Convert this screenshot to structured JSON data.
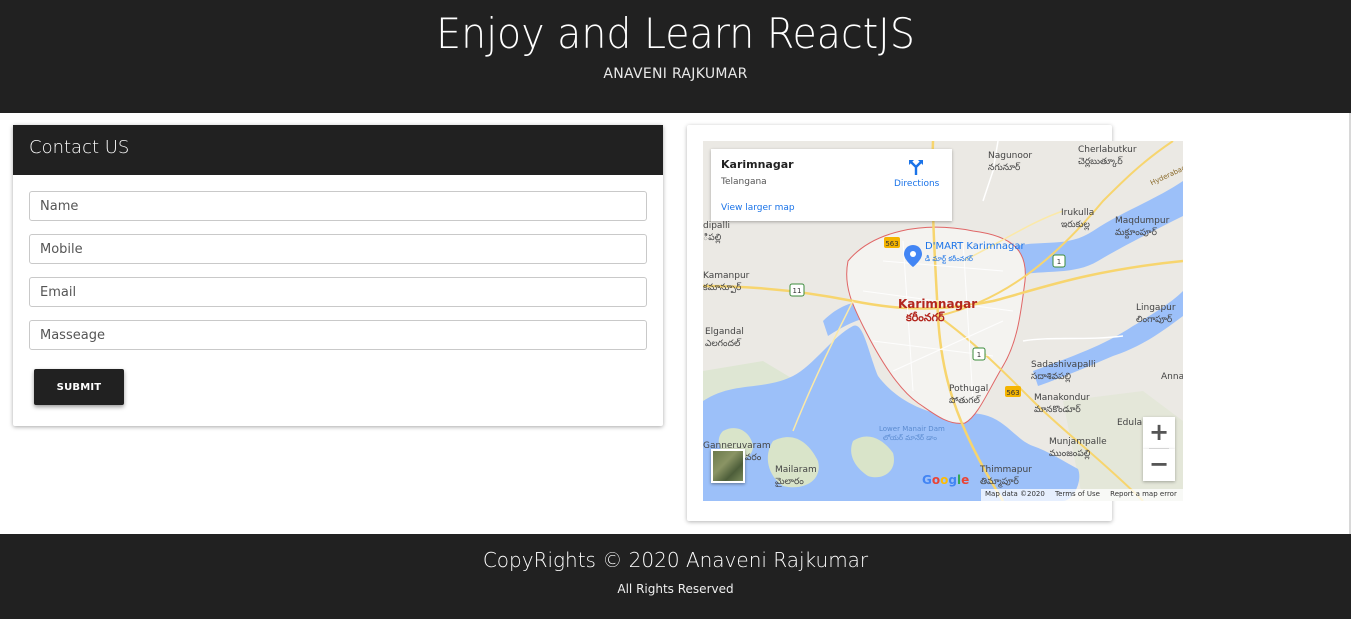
{
  "header": {
    "title": "Enjoy and Learn ReactJS",
    "subtitle": "ANAVENI RAJKUMAR"
  },
  "contact": {
    "heading": "Contact US",
    "fields": {
      "name_placeholder": "Name",
      "mobile_placeholder": "Mobile",
      "email_placeholder": "Email",
      "message_placeholder": "Masseage"
    },
    "submit_label": "SUBMIT"
  },
  "map": {
    "place_name": "Karimnagar",
    "place_region": "Telangana",
    "directions_label": "Directions",
    "larger_map_label": "View larger map",
    "zoom_in": "+",
    "zoom_out": "−",
    "google_logo": "Google",
    "attribution": {
      "map_data": "Map data ©2020",
      "terms": "Terms of Use",
      "report": "Report a map error"
    },
    "labels": {
      "nagunoor": "Nagunoor",
      "nagunoor_te": "నగునూర్",
      "cherlabutkur": "Cherlabutkur",
      "cherlabutkur_te": "చెర్లబుత్కూర్",
      "irukulla": "Irukulla",
      "irukulla_te": "ఇరుకుల్ల",
      "maqdumpur": "Maqdumpur",
      "maqdumpur_te": "మక్దూంపూర్",
      "dipalli": "dipalli",
      "dipalli_te": "ిపల్లి",
      "dmart": "D'MART Karimnagar",
      "dmart_te": "డీ మార్ట్ కరీంనగర్",
      "kamanpur": "Kamanpur",
      "kamanpur_te": "కమాన్పూర్",
      "karimnagar_city": "Karimnagar",
      "karimnagar_city_te": "కరీంనగర్",
      "lingapur": "Lingapur",
      "lingapur_te": "లింగాపూర్",
      "elgandal": "Elgandal",
      "elgandal_te": "ఎలగందల్",
      "sadashivapalli": "Sadashivapalli",
      "sadashivapalli_te": "సదాశివపల్లి",
      "anna": "Anna",
      "pothugal": "Pothugal",
      "pothugal_te": "పోతుగల్",
      "manakondur": "Manakondur",
      "manakondur_te": "మానకొండూర్",
      "lower_manair": "Lower Manair Dam",
      "lower_manair_te": "లోయర్ మానేర్ డాం",
      "edula": "Edula",
      "ganneruvaram": "Ganneruvaram",
      "ganneruvaram_te": "వరం",
      "munjampalle": "Munjampalle",
      "munjampalle_te": "ముంజంపల్లి",
      "mailaram": "Mailaram",
      "mailaram_te": "మైలారం",
      "thimmapur": "Thimmapur",
      "thimmapur_te": "తిమ్మాపూర్",
      "hyderabad": "Hyderabad - Manc",
      "shield_563a": "563",
      "shield_563b": "563",
      "shield_11": "11",
      "shield_1a": "1",
      "shield_1b": "1"
    }
  },
  "footer": {
    "copyright": "CopyRights © 2020 Anaveni Rajkumar",
    "rights": "All Rights Reserved"
  },
  "colors": {
    "dark": "#212121",
    "water": "#9cc0f9",
    "link": "#1a73e8",
    "city_label": "#b3261e"
  }
}
